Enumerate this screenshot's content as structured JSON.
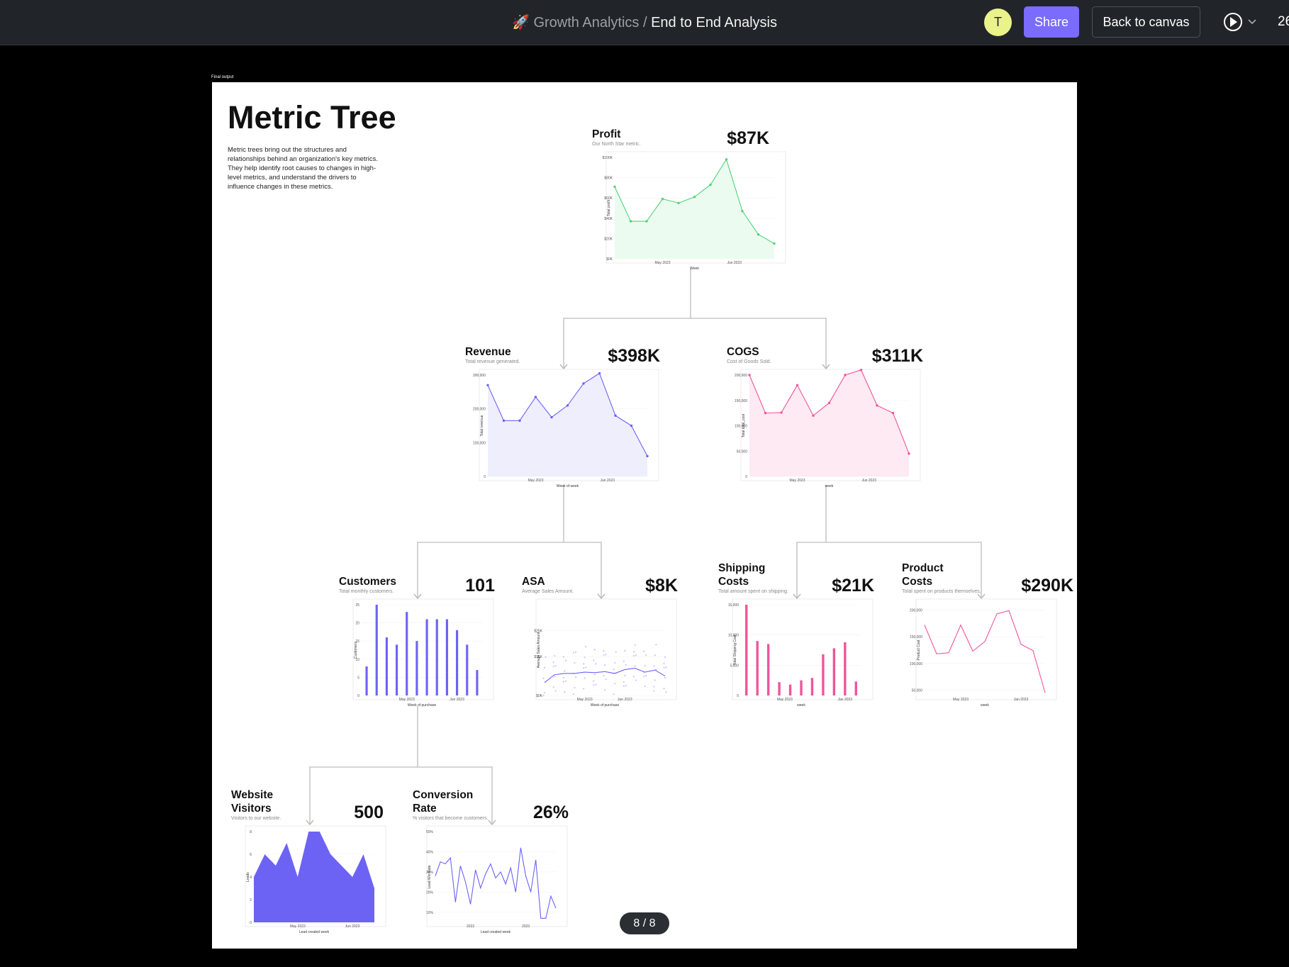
{
  "header": {
    "rocket_icon": "🚀",
    "project": "Growth Analytics",
    "separator": " / ",
    "page": "End to End Analysis",
    "avatar_initial": "T",
    "share_label": "Share",
    "back_label": "Back to canvas",
    "counter": "26"
  },
  "frame_label": "Final output",
  "canvas": {
    "title": "Metric Tree",
    "description": "Metric trees bring out the structures and relationships behind an organization's key metrics. They help identify root causes to changes in high-level metrics, and understand the drivers to influence changes in these metrics."
  },
  "pager": "8 / 8",
  "cards": {
    "profit": {
      "name": "Profit",
      "sub": "Our North Star metric.",
      "value": "$87K"
    },
    "revenue": {
      "name": "Revenue",
      "sub": "Total revenue generated.",
      "value": "$398K"
    },
    "cogs": {
      "name": "COGS",
      "sub": "Cost of Goods Sold.",
      "value": "$311K"
    },
    "customers": {
      "name": "Customers",
      "sub": "Total monthly customers.",
      "value": "101"
    },
    "asa": {
      "name": "ASA",
      "sub": "Average Sales Amount.",
      "value": "$8K"
    },
    "shipping": {
      "name": "Shipping Costs",
      "sub": "Total amount spent on shipping.",
      "value": "$21K"
    },
    "product": {
      "name": "Product Costs",
      "sub": "Total spent on products themselves.",
      "value": "$290K"
    },
    "visitors": {
      "name": "Website Visitors",
      "sub": "Visitors to our website.",
      "value": "500"
    },
    "conversion": {
      "name": "Conversion Rate",
      "sub": "% visitors that become customers.",
      "value": "26%"
    }
  },
  "chart_data": [
    {
      "id": "profit",
      "type": "area",
      "color": "#4cd47a",
      "fill": "#ecfbf0",
      "markers": true,
      "xlabel": "Week",
      "ylabel": "Total profit",
      "ylim": [
        0,
        100000
      ],
      "yticks": [
        0,
        20000,
        40000,
        60000,
        80000,
        100000
      ],
      "ytick_labels": [
        "$0K",
        "$20K",
        "$40K",
        "$60K",
        "$80K",
        "$100K"
      ],
      "xtick_labels": [
        "May 2023",
        "Jun 2023"
      ],
      "xtick_pos": [
        3,
        7.5
      ],
      "values": [
        71000,
        37000,
        37000,
        59000,
        55000,
        61000,
        73000,
        98000,
        47000,
        24000,
        15000
      ]
    },
    {
      "id": "revenue",
      "type": "area",
      "color": "#6c63f5",
      "fill": "#efeefd",
      "markers": true,
      "xlabel": "Week of week",
      "ylabel": "Total revenue",
      "ylim": [
        0,
        300000
      ],
      "yticks": [
        0,
        100000,
        200000,
        300000
      ],
      "ytick_labels": [
        "0",
        "100,000",
        "200,000",
        "300,000"
      ],
      "xtick_labels": [
        "May 2023",
        "Jun 2023"
      ],
      "xtick_pos": [
        3,
        7.5
      ],
      "values": [
        270000,
        165000,
        165000,
        235000,
        175000,
        210000,
        275000,
        305000,
        180000,
        150000,
        60000
      ]
    },
    {
      "id": "cogs",
      "type": "area",
      "color": "#f0559a",
      "fill": "#fdeaf2",
      "markers": true,
      "xlabel": "week",
      "ylabel": "Total total_cost",
      "ylim": [
        0,
        200000
      ],
      "yticks": [
        0,
        50000,
        100000,
        150000,
        200000
      ],
      "ytick_labels": [
        "0",
        "50,000",
        "100,000",
        "150,000",
        "200,000"
      ],
      "xtick_labels": [
        "May 2023",
        "Jun 2023"
      ],
      "xtick_pos": [
        3,
        7.5
      ],
      "values": [
        200000,
        125000,
        126000,
        180000,
        120000,
        145000,
        200000,
        210000,
        140000,
        125000,
        45000
      ]
    },
    {
      "id": "customers",
      "type": "bar",
      "color": "#6c63f5",
      "xlabel": "Week of purchase",
      "ylabel": "Customers",
      "ylim": [
        0,
        25
      ],
      "yticks": [
        0,
        5,
        10,
        15,
        20,
        25
      ],
      "ytick_labels": [
        "0",
        "5",
        "10",
        "15",
        "20",
        "25"
      ],
      "xtick_labels": [
        "May 2023",
        "Jun 2023"
      ],
      "xtick_pos": [
        4,
        9
      ],
      "values": [
        8,
        25,
        16,
        14,
        23,
        15,
        21,
        21,
        21,
        18,
        14,
        7
      ]
    },
    {
      "id": "asa",
      "type": "scatter-line",
      "color": "#6c63f5",
      "xlabel": "Week of purchase",
      "ylabel": "Average Sales Amount",
      "ylim": [
        0,
        35000
      ],
      "yticks": [
        0,
        15000,
        25000
      ],
      "ytick_labels": [
        "$0K",
        "$15K",
        "$25K"
      ],
      "xtick_labels": [
        "May 2023",
        "Jun 2023"
      ],
      "xtick_pos": [
        4,
        8
      ],
      "values": [
        5000,
        8000,
        8500,
        8500,
        9000,
        8800,
        9200,
        8500,
        10000,
        10500,
        9000,
        9800,
        7500
      ]
    },
    {
      "id": "shipping",
      "type": "bar",
      "color": "#f0559a",
      "xlabel": "week",
      "ylabel": "Total Shipping Cost",
      "ylim": [
        0,
        15000
      ],
      "yticks": [
        0,
        5000,
        10000,
        15000
      ],
      "ytick_labels": [
        "0",
        "5,000",
        "10,000",
        "15,000"
      ],
      "xtick_labels": [
        "May 2023",
        "Jan 2023"
      ],
      "xtick_pos": [
        3.5,
        9
      ],
      "values": [
        15000,
        9000,
        8500,
        2200,
        1800,
        2500,
        2900,
        6800,
        7800,
        8800,
        2300
      ]
    },
    {
      "id": "product",
      "type": "line",
      "color": "#f0559a",
      "markers": false,
      "xlabel": "week",
      "ylabel": "Product Cost",
      "ylim": [
        40000,
        210000
      ],
      "yticks": [
        50000,
        100000,
        150000,
        200000
      ],
      "ytick_labels": [
        "50,000",
        "100,000",
        "150,000",
        "200,000"
      ],
      "xtick_labels": [
        "May 2023",
        "Jan 2023"
      ],
      "xtick_pos": [
        3,
        8
      ],
      "values": [
        172000,
        118000,
        120000,
        172000,
        123000,
        141000,
        193000,
        199000,
        136000,
        124000,
        45000
      ]
    },
    {
      "id": "visitors",
      "type": "filled",
      "color": "#6c63f5",
      "fill": "#6c63f5",
      "xlabel": "Lead created week",
      "ylabel": "Leads",
      "ylim": [
        0,
        8
      ],
      "yticks": [
        0,
        2,
        4,
        6,
        8
      ],
      "ytick_labels": [
        "0",
        "2",
        "4",
        "6",
        "8"
      ],
      "xtick_labels": [
        "May 2023",
        "Jun 2023"
      ],
      "xtick_pos": [
        4,
        9
      ],
      "values": [
        4,
        6,
        5,
        7,
        4,
        8,
        8,
        6,
        5,
        4,
        6,
        3
      ]
    },
    {
      "id": "conversion",
      "type": "line",
      "color": "#6c63f5",
      "markers": false,
      "xlabel": "Lead created week",
      "ylabel": "Lead Win Rate",
      "ylim": [
        5,
        50
      ],
      "yticks": [
        10,
        20,
        30,
        40,
        50
      ],
      "ytick_labels": [
        "10%",
        "20%",
        "30%",
        "40%",
        "50%"
      ],
      "xtick_labels": [
        "2022",
        "2023"
      ],
      "xtick_pos": [
        7,
        18
      ],
      "values": [
        28,
        35,
        34,
        37,
        15,
        33,
        25,
        14,
        31,
        22,
        29,
        34,
        27,
        30,
        24,
        32,
        20,
        42,
        28,
        20,
        36,
        7,
        7,
        18,
        12
      ]
    }
  ]
}
